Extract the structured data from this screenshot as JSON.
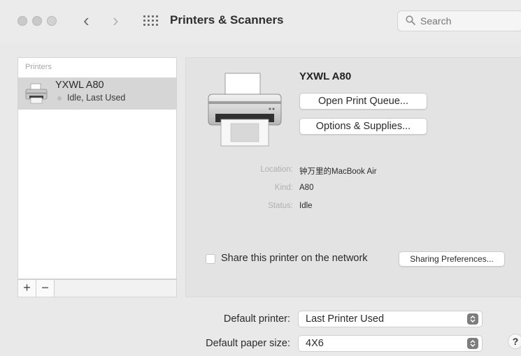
{
  "window": {
    "title": "Printers & Scanners",
    "nav_back": "‹",
    "nav_forward": "›"
  },
  "search": {
    "placeholder": "Search"
  },
  "printers_list": {
    "header": "Printers",
    "items": [
      {
        "name": "YXWL A80",
        "status": "Idle, Last Used"
      }
    ],
    "add_label": "+",
    "remove_label": "−"
  },
  "detail": {
    "printer_name": "YXWL A80",
    "open_queue_label": "Open Print Queue...",
    "options_label": "Options & Supplies...",
    "location_label": "Location:",
    "location_value": "钟万里的MacBook Air",
    "kind_label": "Kind:",
    "kind_value": "A80",
    "status_label": "Status:",
    "status_value": "Idle",
    "share_label": "Share this printer on the network",
    "share_checked": false,
    "sharing_prefs_label": "Sharing Preferences..."
  },
  "defaults": {
    "printer_label": "Default printer:",
    "printer_value": "Last Printer Used",
    "paper_label": "Default paper size:",
    "paper_value": "4X6"
  },
  "help_label": "?",
  "icons": [
    "printer-icon",
    "search-icon",
    "grid-icon",
    "updown-arrows-icon"
  ]
}
